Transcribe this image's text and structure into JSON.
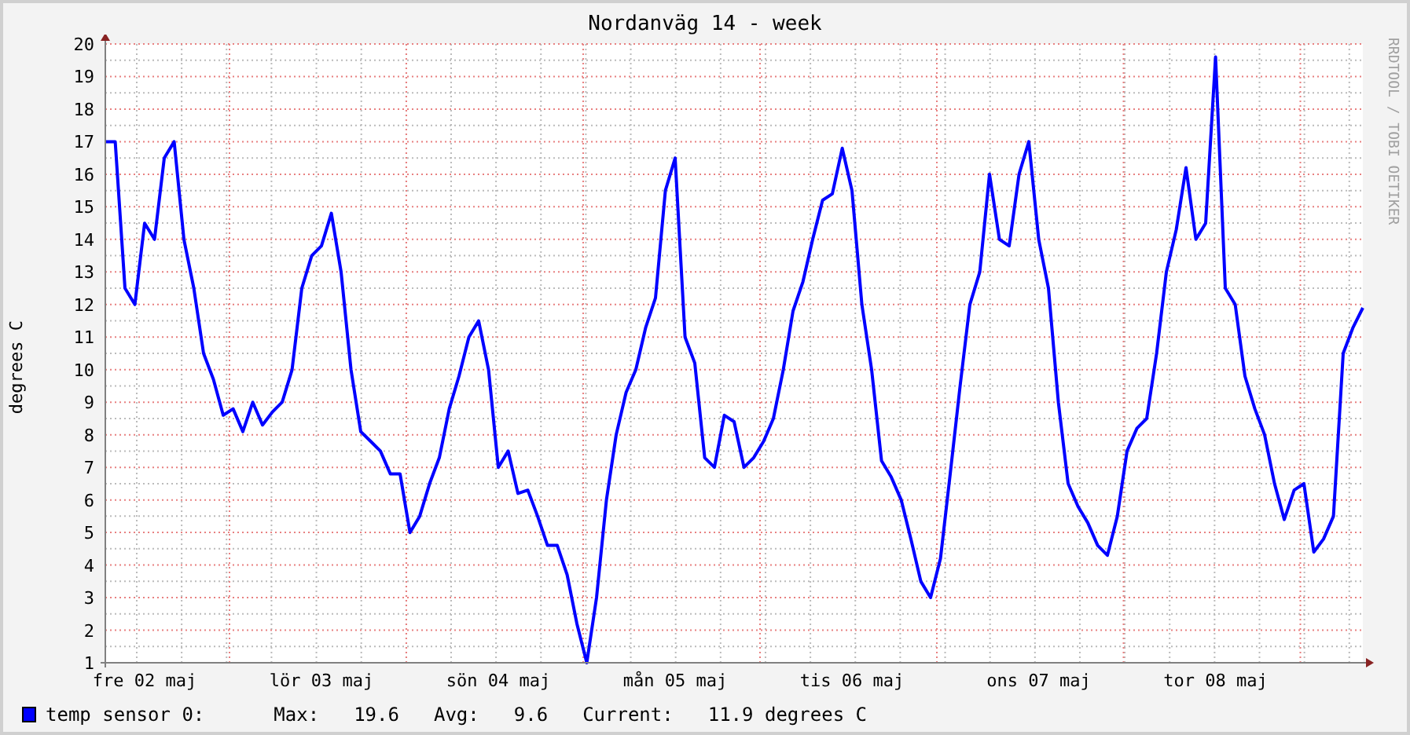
{
  "title": "Nordanväg 14 - week",
  "credit": "RRDTOOL / TOBI OETIKER",
  "chart": {
    "chart_data": {
      "type": "line",
      "grid": true,
      "ylabel": "degrees C",
      "ylim": [
        1,
        20
      ],
      "yticks": [
        1,
        2,
        3,
        4,
        5,
        6,
        7,
        8,
        9,
        10,
        11,
        12,
        13,
        14,
        15,
        16,
        17,
        18,
        19,
        20
      ],
      "categories": [
        null,
        null,
        null,
        null,
        "fre 02 maj",
        null,
        null,
        null,
        null,
        null,
        null,
        null,
        null,
        null,
        null,
        null,
        null,
        null,
        null,
        null,
        null,
        null,
        "lör 03 maj",
        null,
        null,
        null,
        null,
        null,
        null,
        null,
        null,
        null,
        null,
        null,
        null,
        null,
        null,
        null,
        null,
        null,
        "sön 04 maj",
        null,
        null,
        null,
        null,
        null,
        null,
        null,
        null,
        null,
        null,
        null,
        null,
        null,
        null,
        null,
        null,
        null,
        "mån 05 maj",
        null,
        null,
        null,
        null,
        null,
        null,
        null,
        null,
        null,
        null,
        null,
        null,
        null,
        null,
        null,
        null,
        null,
        "tis 06 maj",
        null,
        null,
        null,
        null,
        null,
        null,
        null,
        null,
        null,
        null,
        null,
        null,
        null,
        null,
        null,
        null,
        null,
        null,
        "ons 07 maj",
        null,
        null,
        null,
        null,
        null,
        null,
        null,
        null,
        null,
        null,
        null,
        null,
        null,
        null,
        null,
        null,
        null,
        "tor 08 maj",
        null,
        null,
        null,
        null,
        null,
        null,
        null,
        null,
        null,
        null,
        null,
        null,
        null,
        null,
        null
      ],
      "series": [
        {
          "name": "temp sensor 0:",
          "color": "#0000ff",
          "values": [
            17.0,
            17.0,
            12.5,
            12.0,
            14.5,
            14.0,
            16.5,
            17.0,
            14.0,
            12.5,
            10.5,
            9.7,
            8.6,
            8.8,
            8.1,
            9.0,
            8.3,
            8.7,
            9.0,
            10.0,
            12.5,
            13.5,
            13.8,
            14.8,
            13.0,
            10.0,
            8.1,
            7.8,
            7.5,
            6.8,
            6.8,
            5.0,
            5.5,
            6.5,
            7.3,
            8.8,
            9.8,
            11.0,
            11.5,
            10.0,
            7.0,
            7.5,
            6.2,
            6.3,
            5.5,
            4.6,
            4.6,
            3.7,
            2.2,
            1.0,
            3.0,
            6.0,
            8.0,
            9.3,
            10.0,
            11.3,
            12.2,
            15.5,
            16.5,
            11.0,
            10.2,
            7.3,
            7.0,
            8.6,
            8.4,
            7.0,
            7.3,
            7.8,
            8.5,
            10.0,
            11.8,
            12.7,
            14.0,
            15.2,
            15.4,
            16.8,
            15.5,
            12.0,
            10.0,
            7.2,
            6.7,
            6.0,
            4.8,
            3.5,
            3.0,
            4.2,
            6.8,
            9.5,
            12.0,
            13.0,
            16.0,
            14.0,
            13.8,
            16.0,
            17.0,
            14.0,
            12.5,
            9.0,
            6.5,
            5.8,
            5.3,
            4.6,
            4.3,
            5.5,
            7.5,
            8.2,
            8.5,
            10.5,
            13.0,
            14.3,
            16.2,
            14.0,
            14.5,
            19.6,
            12.5,
            12.0,
            9.8,
            8.8,
            8.0,
            6.5,
            5.4,
            6.3,
            6.5,
            4.4,
            4.8,
            5.5,
            10.5,
            11.3,
            11.9
          ]
        }
      ]
    }
  },
  "legend": {
    "items": [
      {
        "label": "Max:",
        "value": "19.6"
      },
      {
        "label": "Avg:",
        "value": "9.6"
      },
      {
        "label": "Current:",
        "value": "11.9 degrees C"
      }
    ]
  }
}
